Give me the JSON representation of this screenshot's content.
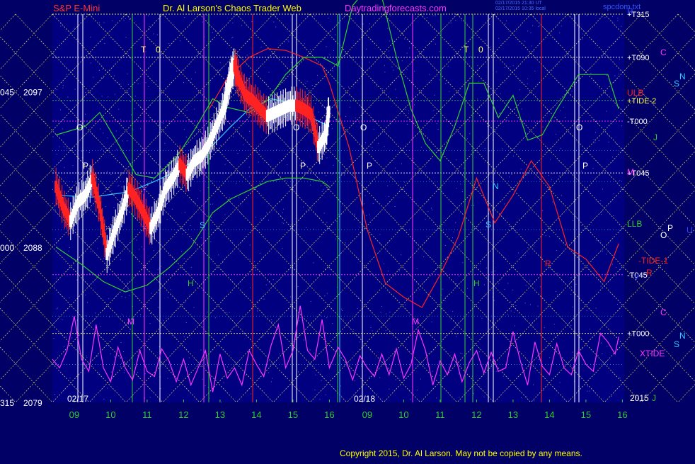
{
  "header": {
    "symbol": "S&P E-Mini",
    "author": "Dr. Al Larson's Chaos Trader Web",
    "site": "Daytradingforecasts.com",
    "timestamp_1": "02/17/2015 21:30 UT",
    "timestamp_2": "02/17/2015 10:35 local",
    "file": "spcdom.txt"
  },
  "copyright": "Copyright 2015, Dr. Al Larson. May not be copied by any means.",
  "colors": {
    "background": "#000066",
    "plot_background": "#000080",
    "grid_dots": "#9999ff",
    "yellow_lines": "#ffff66",
    "magenta": "#ff33ff",
    "green": "#33cc33",
    "red": "#ff2222",
    "white": "#ffffff",
    "cyan": "#33ccff"
  },
  "chart_data": {
    "type": "line",
    "title": "S&P E-Mini",
    "xlabel": "",
    "ylabel": "",
    "ylim": [
      2079,
      2101.5
    ],
    "x_range": [
      8.4,
      16
    ],
    "grid": true,
    "date_labels": [
      "02/17",
      "02/18"
    ],
    "x_ticks": [
      "09",
      "10",
      "11",
      "12",
      "13",
      "14",
      "15",
      "16",
      "09",
      "10",
      "11",
      "12",
      "13",
      "14",
      "15",
      "16"
    ],
    "y_ticks": [
      {
        "value": 2097,
        "left": "045",
        "label": "2097"
      },
      {
        "value": 2088,
        "left": "000",
        "label": "2088"
      },
      {
        "value": 2079,
        "left": "315",
        "label": "2079"
      }
    ],
    "horizontal_levels": [
      {
        "label": "+T315",
        "value": 2101.5
      },
      {
        "label": "+T090",
        "value": 2099.0
      },
      {
        "label": "+TIDE-2",
        "value": 2096.5
      },
      {
        "label": "-T000",
        "value": 2095.3
      },
      {
        "label": "+T045",
        "value": 2092.3
      },
      {
        "label": "-T045",
        "value": 2086.4
      },
      {
        "label": "+T000",
        "value": 2083.0
      }
    ],
    "right_markers": [
      "R",
      "C",
      "N",
      "S",
      "ULB",
      "J",
      "M",
      "LLB",
      "O",
      "P",
      "U",
      "-TIDE-1",
      "R",
      "V",
      "C",
      "N",
      "S",
      "XTIDE",
      "2015",
      "J"
    ],
    "chart_markers": [
      "T",
      "0",
      "T",
      "0",
      "O",
      "P",
      "O",
      "P",
      "O",
      "P",
      "O",
      "P",
      "H",
      "H",
      "M",
      "M",
      "N",
      "S",
      "R",
      "S"
    ],
    "series": [
      {
        "name": "",
        "color": "#ffffff",
        "x": [
          8.5,
          8.7,
          8.9,
          9.1,
          9.3,
          9.5,
          9.7,
          9.9,
          10.1,
          10.3,
          10.5,
          10.7,
          10.9,
          11.1,
          11.3,
          11.5,
          11.7,
          11.9,
          12.1,
          12.3,
          12.5,
          12.7,
          12.9,
          13.1,
          13.2,
          13.3,
          13.4,
          13.5,
          13.7,
          13.9,
          14.1,
          14.3,
          14.5,
          14.7,
          14.9,
          15.1,
          15.3,
          15.5,
          15.7,
          15.9,
          16.0
        ],
        "values": [
          2091.5,
          2090.3,
          2089.5,
          2090.6,
          2091.0,
          2092.0,
          2090.3,
          2087.6,
          2088.9,
          2090.0,
          2091.4,
          2090.8,
          2090.0,
          2089.1,
          2090.0,
          2091.4,
          2092.0,
          2092.8,
          2092.2,
          2093.0,
          2093.3,
          2094.0,
          2095.0,
          2096.0,
          2097.0,
          2098.0,
          2098.5,
          2097.8,
          2096.8,
          2096.5,
          2096.0,
          2095.6,
          2095.8,
          2096.0,
          2096.2,
          2096.2,
          2096.0,
          2095.7,
          2093.8,
          2094.5,
          2096.1
        ]
      },
      {
        "name": "",
        "color": "#33ccff",
        "x": [
          8.5,
          9.5,
          10.5,
          11.2,
          12.0,
          12.8,
          13.3,
          13.8,
          14.4,
          15.0,
          15.6,
          16.0
        ],
        "values": [
          2091.0,
          2090.9,
          2091.2,
          2091.8,
          2092.6,
          2093.9,
          2095.0,
          2096.0,
          2096.6,
          2096.3,
          2095.4,
          2095.0
        ]
      },
      {
        "name": "",
        "color": "#ff2222",
        "x": [
          12.7,
          13.2,
          13.8,
          14.3,
          14.8,
          15.3,
          15.8,
          16.0,
          16.5,
          17.0,
          17.5,
          18.0,
          18.5,
          19.0,
          19.5,
          20.0,
          20.5,
          21.0,
          21.5,
          22.0,
          22.5,
          23.0,
          23.5,
          23.9
        ],
        "values": [
          2096.0,
          2097.8,
          2099.0,
          2099.5,
          2099.4,
          2099.0,
          2098.5,
          2097.5,
          2093.8,
          2089.0,
          2085.9,
          2085.1,
          2084.5,
          2086.4,
          2088.6,
          2092.0,
          2089.4,
          2091.0,
          2093.0,
          2091.5,
          2088.0,
          2087.3,
          2086.0,
          2088.2
        ]
      },
      {
        "name": "",
        "color": "#33cc33",
        "x": [
          8.5,
          9.3,
          9.7,
          10.2,
          10.7,
          11.2,
          11.8,
          12.3,
          12.8,
          13.2,
          13.8,
          14.3,
          14.8,
          15.3,
          15.8,
          16.2,
          16.6,
          17.0,
          17.4,
          17.8,
          18.2,
          18.6,
          19.0,
          19.4,
          19.8,
          20.2,
          20.6,
          21.0,
          21.4,
          21.8,
          22.2,
          22.5,
          22.8,
          23.2,
          23.6,
          23.9
        ],
        "values": [
          2094.5,
          2095.0,
          2095.8,
          2094.0,
          2092.2,
          2092.0,
          2093.2,
          2094.8,
          2096.6,
          2096.1,
          2095.8,
          2096.5,
          2098.0,
          2099.0,
          2099.0,
          2098.5,
          2102.0,
          2103.0,
          2102.5,
          2099.0,
          2096.0,
          2094.0,
          2093.0,
          2095.0,
          2097.5,
          2097.5,
          2095.5,
          2096.8,
          2094.2,
          2094.5,
          2096.0,
          2097.0,
          2098.0,
          2098.0,
          2098.0,
          2096.0
        ]
      },
      {
        "name": "",
        "color": "#33cc33",
        "x": [
          8.5,
          9.2,
          9.8,
          10.4,
          11.0,
          11.6,
          12.2,
          12.8,
          13.3,
          13.8,
          14.3,
          14.8,
          15.3,
          15.8,
          16.0
        ],
        "values": [
          2088.0,
          2087.0,
          2086.0,
          2085.4,
          2085.8,
          2086.8,
          2088.0,
          2090.0,
          2090.8,
          2091.3,
          2091.8,
          2092.0,
          2092.0,
          2091.8,
          2091.5
        ]
      },
      {
        "name": "",
        "color": "#ff33ff",
        "x": [
          8.4,
          8.6,
          8.8,
          9.0,
          9.2,
          9.4,
          9.6,
          9.8,
          10.0,
          10.2,
          10.4,
          10.6,
          10.8,
          11.0,
          11.2,
          11.4,
          11.6,
          11.8,
          12.0,
          12.2,
          12.4,
          12.6,
          12.8,
          13.0,
          13.2,
          13.4,
          13.6,
          13.8,
          14.0,
          14.2,
          14.4,
          14.6,
          14.8,
          15.0,
          15.2,
          15.4,
          15.6,
          15.8,
          16.0,
          16.2,
          16.4,
          16.6,
          16.8,
          17.0,
          17.2,
          17.4,
          17.6,
          17.8,
          18.0,
          18.2,
          18.4,
          18.6,
          18.8,
          19.0,
          19.2,
          19.4,
          19.6,
          19.8,
          20.0,
          20.2,
          20.4,
          20.6,
          20.8,
          21.0,
          21.2,
          21.4,
          21.6,
          21.8,
          22.0,
          22.2,
          22.4,
          22.6,
          22.8,
          23.0,
          23.2,
          23.4,
          23.6,
          23.8,
          23.9
        ],
        "values": [
          2081.5,
          2081.0,
          2082.0,
          2084.0,
          2081.5,
          2080.8,
          2083.5,
          2081.0,
          2080.2,
          2082.2,
          2081.0,
          2080.3,
          2082.0,
          2080.8,
          2080.5,
          2082.1,
          2081.4,
          2080.2,
          2081.5,
          2080.0,
          2081.0,
          2082.0,
          2079.6,
          2081.8,
          2080.4,
          2081.0,
          2080.0,
          2082.0,
          2081.2,
          2080.5,
          2082.3,
          2083.5,
          2081.0,
          2082.0,
          2084.6,
          2082.0,
          2081.5,
          2083.8,
          2081.0,
          2082.2,
          2081.5,
          2080.3,
          2081.7,
          2081.0,
          2080.5,
          2081.8,
          2080.6,
          2082.1,
          2080.4,
          2081.2,
          2083.2,
          2082.0,
          2080.0,
          2081.4,
          2080.6,
          2081.8,
          2080.2,
          2081.3,
          2082.0,
          2080.7,
          2081.9,
          2080.8,
          2081.0,
          2083.1,
          2081.4,
          2080.0,
          2082.5,
          2081.1,
          2080.6,
          2082.4,
          2081.0,
          2080.6,
          2082.0,
          2081.2,
          2080.8,
          2083.0,
          2082.5,
          2081.8,
          2082.8
        ]
      }
    ]
  }
}
